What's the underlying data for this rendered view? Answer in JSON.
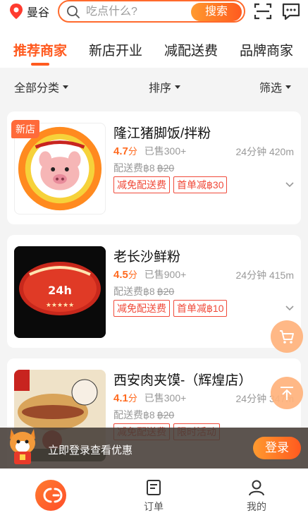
{
  "header": {
    "location": "曼谷",
    "search_placeholder": "吃点什么?",
    "search_button": "搜索"
  },
  "tabs": [
    "推荐商家",
    "新店开业",
    "减配送费",
    "品牌商家"
  ],
  "filters": [
    "全部分类",
    "排序",
    "筛选"
  ],
  "restaurants": [
    {
      "name": "隆江猪脚饭/拌粉",
      "rating": "4.7",
      "rating_unit": "分",
      "sold": "已售300+",
      "time_distance": "24分钟 420m",
      "fee_label": "配送费",
      "fee": "฿8",
      "fee_original": "฿20",
      "tags": [
        "减免配送费",
        "首单减฿30"
      ],
      "badge": "新店"
    },
    {
      "name": "老长沙鲜粉",
      "rating": "4.5",
      "rating_unit": "分",
      "sold": "已售900+",
      "time_distance": "24分钟 415m",
      "fee_label": "配送费",
      "fee": "฿8",
      "fee_original": "฿20",
      "tags": [
        "减免配送费",
        "首单减฿10"
      ]
    },
    {
      "name": "西安肉夹馍-（辉煌店）",
      "rating": "4.1",
      "rating_unit": "分",
      "sold": "已售300+",
      "time_distance": "24分钟 347m",
      "fee_label": "配送费",
      "fee": "฿8",
      "fee_original": "฿20",
      "tags": [
        "减免配送费",
        "限时活动"
      ]
    }
  ],
  "login_bar": {
    "text": "立即登录查看优惠",
    "button": "登录"
  },
  "bottom_nav": {
    "orders": "订单",
    "mine": "我的"
  },
  "colors": {
    "accent": "#ff5a1f",
    "tag_red": "#f04a3a"
  }
}
